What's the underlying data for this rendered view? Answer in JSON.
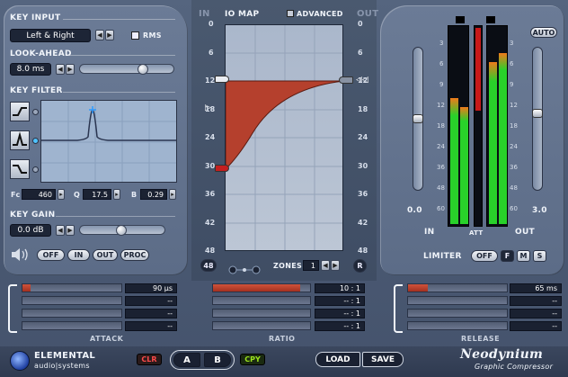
{
  "key_input": {
    "label": "KEY INPUT",
    "source": "Left & Right",
    "rms": "RMS"
  },
  "look_ahead": {
    "label": "LOOK-AHEAD",
    "value": "8.0 ms",
    "slider_level": 0.72
  },
  "key_filter": {
    "label": "KEY FILTER",
    "fc_label": "Fc",
    "fc": "460",
    "q_label": "Q",
    "q": "17.5",
    "b_label": "B",
    "b": "0.29"
  },
  "key_gain": {
    "label": "KEY GAIN",
    "value": "0.0 dB",
    "slider_level": 0.5
  },
  "monitor": {
    "off": "OFF",
    "in": "IN",
    "out": "OUT",
    "proc": "PROC"
  },
  "io_map": {
    "in_label": "IN",
    "title": "IO MAP",
    "advanced": "ADVANCED",
    "out_label": "OUT",
    "ticks": [
      "0",
      "6",
      "12",
      "18",
      "24",
      "30",
      "36",
      "42",
      "48"
    ],
    "zones_label": "ZONES",
    "zones": "1",
    "range_btn": "48",
    "reset_btn": "R"
  },
  "meters": {
    "auto": "AUTO",
    "in_value": "0.0",
    "out_value": "3.0",
    "in_label": "IN",
    "att_label": "ATT",
    "out_label": "OUT",
    "scale": [
      "3",
      "6",
      "9",
      "12",
      "18",
      "24",
      "36",
      "48",
      "60"
    ],
    "in_gain_level": 0.6,
    "out_gain_level": 0.35,
    "colors": {
      "meter_green": "#29d12a",
      "meter_red": "#c81919",
      "meter_orange": "#f07a1b"
    }
  },
  "limiter": {
    "label": "LIMITER",
    "off": "OFF",
    "f": "F",
    "m": "M",
    "s": "S"
  },
  "attack": {
    "label": "ATTACK",
    "values": [
      "90 µs",
      "--",
      "--",
      "--"
    ],
    "level": 0.08
  },
  "ratio": {
    "label": "RATIO",
    "values": [
      "10 : 1",
      "-- : 1",
      "-- : 1",
      "-- : 1"
    ],
    "level": 0.9
  },
  "release": {
    "label": "RELEASE",
    "values": [
      "65 ms",
      "--",
      "--",
      "--"
    ],
    "level": 0.2
  },
  "footer": {
    "brand_top": "ELEMENTAL",
    "brand_bottom": "audio|systems",
    "clr": "CLR",
    "a": "A",
    "b": "B",
    "cpy": "CPY",
    "load": "LOAD",
    "save": "SAVE",
    "product": "Neodynium",
    "subtitle": "Graphic Compressor"
  },
  "colors": {
    "curve_fill": "#b5402d",
    "accent_red": "#c41f1f",
    "cpy_green": "#9be31e"
  }
}
